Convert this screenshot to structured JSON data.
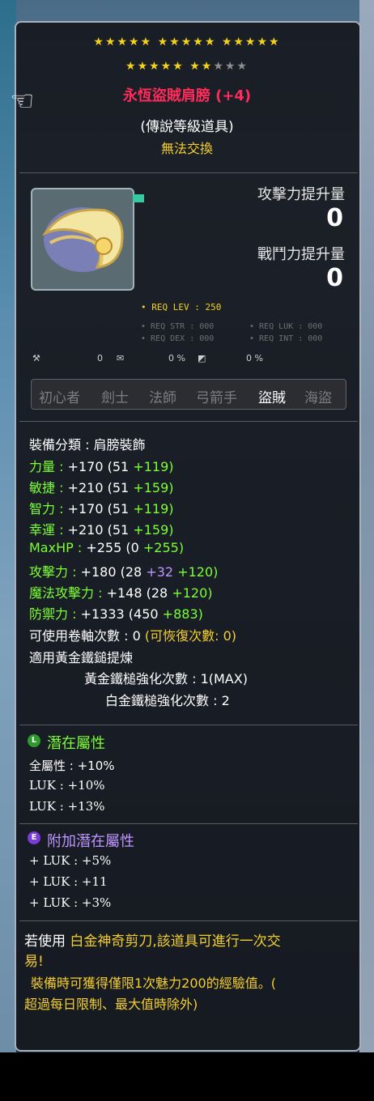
{
  "item": {
    "stars_row1": "★★★★★ ★★★★★ ★★★★★",
    "stars_row2_on": "★★★★★ ★★",
    "stars_row2_off": "★★★",
    "name": "永恆盜賊肩膀 (+4)",
    "grade": "(傳說等級道具)",
    "untradeable": "無法交換"
  },
  "stats_preview": {
    "attack_label": "攻擊力提升量",
    "attack_value": "0",
    "power_label": "戰鬥力提升量",
    "power_value": "0"
  },
  "requirements": {
    "level": "• REQ LEV : 250",
    "str": "• REQ STR : 000",
    "luk": "• REQ LUK : 000",
    "dex": "• REQ DEX : 000",
    "int": "• REQ INT : 000"
  },
  "small_stats": {
    "a": "0",
    "b": "0 %",
    "c": "0 %"
  },
  "classes": [
    "初心者",
    "劍士",
    "法師",
    "弓箭手",
    "盜賊",
    "海盜"
  ],
  "active_class": "盜賊",
  "details": {
    "category": "裝備分類 : 肩膀裝飾",
    "str": {
      "label": "力量 :",
      "total": "+170",
      "base": "(51",
      "bonus": "+119)"
    },
    "dex": {
      "label": "敏捷 :",
      "total": "+210",
      "base": "(51",
      "bonus": "+159)"
    },
    "int": {
      "label": "智力 :",
      "total": "+170",
      "base": "(51",
      "bonus": "+119)"
    },
    "luk": {
      "label": "幸運 :",
      "total": "+210",
      "base": "(51",
      "bonus": "+159)"
    },
    "hp": {
      "label": "MaxHP :",
      "total": "+255",
      "base": "(0",
      "bonus": "+255)"
    },
    "atk": {
      "label": "攻擊力 :",
      "total": "+180",
      "base": "(28",
      "extra": "+32",
      "bonus": "+120)"
    },
    "matk": {
      "label": "魔法攻擊力 :",
      "total": "+148",
      "base": "(28",
      "bonus": "+120)"
    },
    "def": {
      "label": "防禦力 :",
      "total": "+1333",
      "base": "(450",
      "bonus": "+883)"
    },
    "scroll": "可使用卷軸次數 : 0",
    "scroll_restore": "(可恢復次數: 0)",
    "hammer_apply": "適用黃金鐵鎚提煉",
    "hammer_gold": "黃金鐵槌強化次數 : 1(MAX)",
    "hammer_platinum": "白金鐵槌強化次數 : 2"
  },
  "potential": {
    "title": "潛在屬性",
    "badge": "L",
    "lines": [
      "全屬性 : +10%",
      "LUK : +10%",
      "LUK : +13%"
    ]
  },
  "bonus_potential": {
    "title": "附加潛在屬性",
    "badge": "E",
    "lines": [
      "+ LUK : +5%",
      "+ LUK : +11",
      "+ LUK : +3%"
    ]
  },
  "footer": {
    "line1_prefix": "若使用",
    "line1_item": "白金神奇剪刀,該道具可進行一次交",
    "line2": "易!",
    "line3": "裝備時可獲得僅限1次魅力200的經驗值。(",
    "line4": "超過每日限制、最大值時除外)"
  },
  "colors": {
    "name": "#ff2b5a",
    "gold": "#f4cf2f",
    "green": "#7cff36",
    "potential_badge": "#2e9a2e",
    "bonus_badge": "#7a3bd6"
  }
}
